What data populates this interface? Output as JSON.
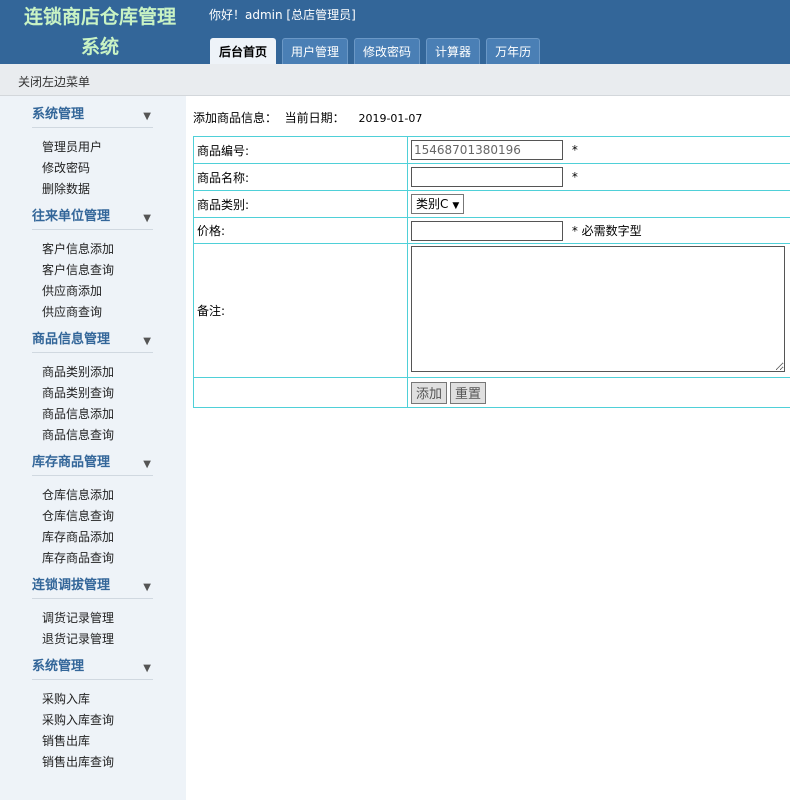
{
  "header": {
    "logo_line1": "连锁商店仓库管理",
    "logo_line2": "系统",
    "greeting": "你好！admin [总店管理员]",
    "tabs": [
      {
        "label": "后台首页",
        "active": true
      },
      {
        "label": "用户管理",
        "active": false
      },
      {
        "label": "修改密码",
        "active": false
      },
      {
        "label": "计算器",
        "active": false
      },
      {
        "label": "万年历",
        "active": false
      }
    ]
  },
  "toolbar": {
    "toggle_sidebar": "关闭左边菜单"
  },
  "sidebar": {
    "groups": [
      {
        "title": "系统管理",
        "items": [
          "管理员用户",
          "修改密码",
          "删除数据"
        ]
      },
      {
        "title": "往来单位管理",
        "items": [
          "客户信息添加",
          "客户信息查询",
          "供应商添加",
          "供应商查询"
        ]
      },
      {
        "title": "商品信息管理",
        "items": [
          "商品类别添加",
          "商品类别查询",
          "商品信息添加",
          "商品信息查询"
        ]
      },
      {
        "title": "库存商品管理",
        "items": [
          "仓库信息添加",
          "仓库信息查询",
          "库存商品添加",
          "库存商品查询"
        ]
      },
      {
        "title": "连锁调拔管理",
        "items": [
          "调货记录管理",
          "退货记录管理"
        ]
      },
      {
        "title": "系统管理",
        "items": [
          "采购入库",
          "采购入库查询",
          "销售出库",
          "销售出库查询"
        ]
      }
    ],
    "chevron_icon": "chevron-down-icon"
  },
  "main": {
    "info_label": "添加商品信息：  当前日期：",
    "date": "2019-01-07",
    "form": {
      "code_label": "商品编号:",
      "code_value": "15468701380196",
      "name_label": "商品名称:",
      "name_value": "",
      "category_label": "商品类别:",
      "category_value": "类别C",
      "price_label": "价格:",
      "price_value": "",
      "price_hint": "* 必需数字型",
      "note_label": "备注:",
      "note_value": "",
      "required_mark": "*",
      "submit_label": "添加",
      "reset_label": "重置"
    }
  },
  "colors": {
    "header_bg": "#336699",
    "logo_text": "#c9f3c4",
    "sidebar_bg": "#eef3f8",
    "sidebar_title": "#336699",
    "form_border": "#4fd0d8"
  }
}
